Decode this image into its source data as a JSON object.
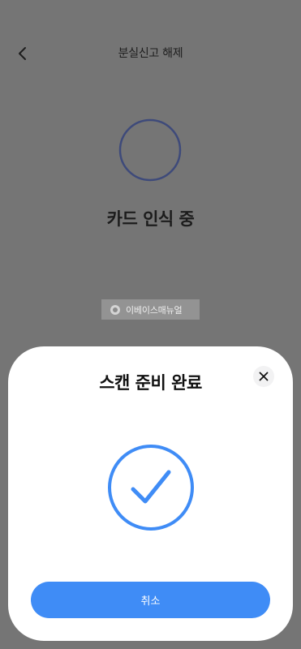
{
  "header": {
    "title": "분실신고 해제"
  },
  "scan_status": {
    "text": "카드 인식 중"
  },
  "watermark": {
    "text": "이베이스매뉴얼"
  },
  "sheet": {
    "title": "스캔 준비 완료",
    "cancel_label": "취소"
  },
  "colors": {
    "accent": "#3f8cf6",
    "spinner": "#3e4a7a",
    "overlay": "#757575"
  },
  "icons": {
    "back": "chevron-left-icon",
    "close": "close-icon",
    "check": "check-circle-icon",
    "watermark": "logo-icon"
  }
}
